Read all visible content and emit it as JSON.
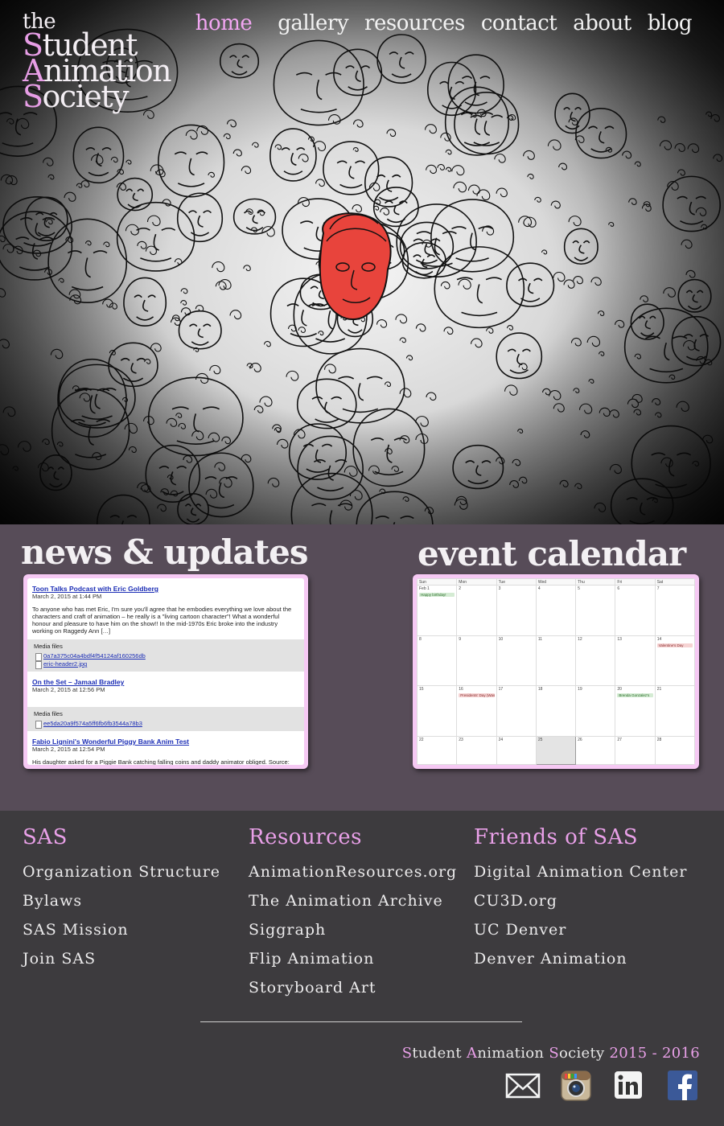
{
  "logo": {
    "the": "the",
    "lines": [
      [
        "S",
        "tudent"
      ],
      [
        "A",
        "nimation"
      ],
      [
        "S",
        "ociety"
      ]
    ]
  },
  "nav": [
    {
      "label": "home",
      "active": true
    },
    {
      "label": "gallery",
      "active": false
    },
    {
      "label": "resources",
      "active": false
    },
    {
      "label": "contact",
      "active": false
    },
    {
      "label": "about",
      "active": false
    },
    {
      "label": "blog",
      "active": false
    }
  ],
  "news": {
    "title": "news & updates",
    "posts": [
      {
        "title": "Toon Talks Podcast with Eric Goldberg",
        "date": "March 2, 2015 at 1:44 PM",
        "body": "To anyone who has met Eric, I'm sure you'll agree that he embodies everything we love about the characters and craft of animation – he really is a \"living cartoon character\"! What a wonderful honour and pleasure to have him on the show!! In the mid-1970s Eric broke into the industry working on Raggedy Ann […]",
        "media_label": "Media files",
        "files": [
          "0a7a375c04a4bdf4f54124af160256db",
          "eric-header2.jpg"
        ]
      },
      {
        "title": "On the Set – Jamaal Bradley",
        "date": "March 2, 2015 at 12:56 PM",
        "body": "",
        "media_label": "Media files",
        "files": [
          "ee5da20a9f574a5ff6fb6fb3544a78b3"
        ]
      },
      {
        "title": "Fabio Lignini's Wonderful Piggy Bank Anim Test",
        "date": "March 2, 2015 at 12:54 PM",
        "body": "His daughter asked for a Piggie Bank catching falling coins and daddy animator obliged. Source: Spungella",
        "media_label": "",
        "files": []
      }
    ]
  },
  "calendar": {
    "title": "event calendar",
    "weekdays": [
      "Sun",
      "Mon",
      "Tue",
      "Wed",
      "Thu",
      "Fri",
      "Sat"
    ],
    "weeks": [
      [
        "Feb 1",
        "2",
        "3",
        "4",
        "5",
        "6",
        "7"
      ],
      [
        "8",
        "9",
        "10",
        "11",
        "12",
        "13",
        "14"
      ],
      [
        "15",
        "16",
        "17",
        "18",
        "19",
        "20",
        "21"
      ],
      [
        "22",
        "23",
        "24",
        "25",
        "26",
        "27",
        "28"
      ]
    ],
    "today": "25",
    "events": [
      {
        "day": "Feb 1",
        "label": "Happy birthday!",
        "color": "green"
      },
      {
        "day": "14",
        "label": "Valentine's Day",
        "color": "pink"
      },
      {
        "day": "16",
        "label": "Presidents' Day (Wash",
        "color": "pink"
      },
      {
        "day": "20",
        "label": "Brenda Gonzalez's",
        "color": "green"
      }
    ]
  },
  "footer": {
    "columns": [
      {
        "heading": "SAS",
        "links": [
          "Organization Structure",
          "Bylaws",
          "SAS Mission",
          "Join SAS"
        ]
      },
      {
        "heading": "Resources",
        "links": [
          "AnimationResources.org",
          "The Animation Archive",
          "Siggraph",
          "Flip Animation",
          "Storyboard Art"
        ]
      },
      {
        "heading": "Friends of SAS",
        "links": [
          "Digital Animation Center",
          "CU3D.org",
          "UC Denver",
          "Denver Animation"
        ]
      }
    ],
    "copyright": {
      "words": [
        [
          "S",
          "tudent"
        ],
        [
          "A",
          "nimation"
        ],
        [
          "S",
          "ociety"
        ]
      ],
      "years": "2015 - 2016"
    },
    "socials": [
      "mail-icon",
      "instagram-icon",
      "linkedin-icon",
      "facebook-icon"
    ]
  },
  "colors": {
    "accent": "#e9a0e8",
    "nav_active": "#f2a6f2",
    "middle_bg": "#574c58",
    "footer_bg": "#3d3b3e",
    "hero_highlight": "#e8443c"
  }
}
